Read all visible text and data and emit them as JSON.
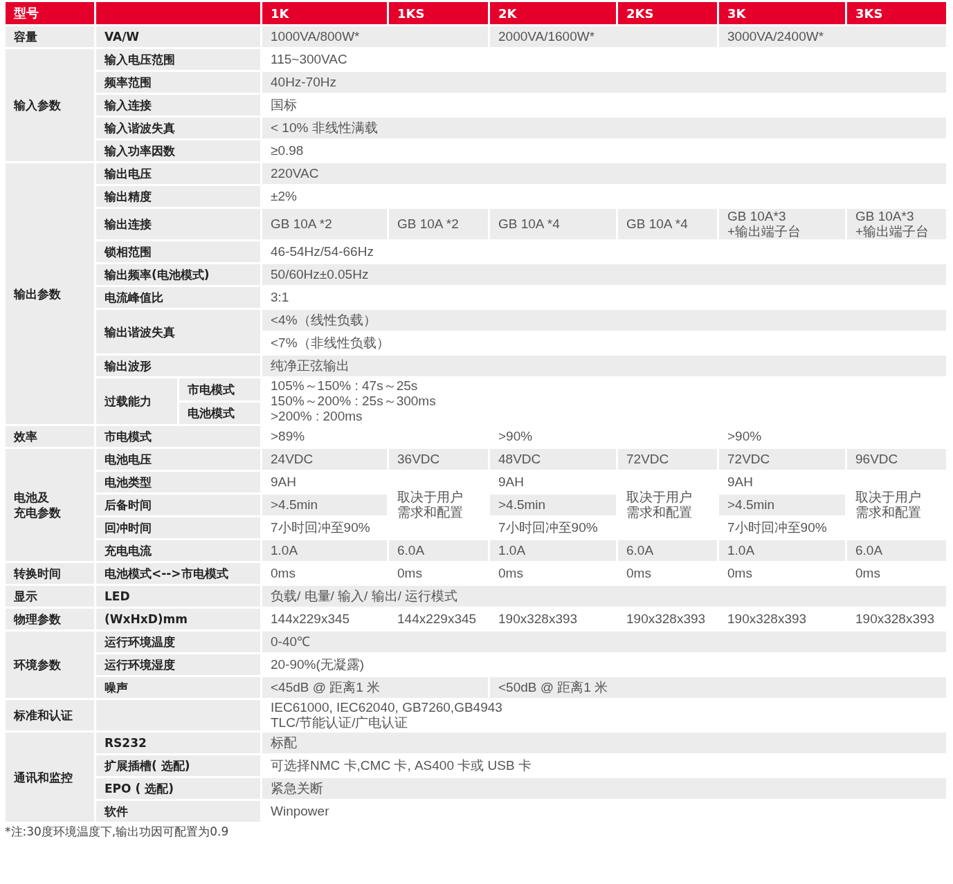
{
  "table": {
    "header": {
      "model": "型号",
      "columns": [
        "1K",
        "1KS",
        "2K",
        "2KS",
        "3K",
        "3KS"
      ]
    },
    "rows": [
      {
        "group": "容量",
        "parameter": "VA/W",
        "values": [
          "1000VA/800W*",
          "2000VA/1600W*",
          "3000VA/2400W*"
        ]
      },
      {
        "group": "输入参数",
        "parameter": "输入电压范围",
        "values": [
          "115~300VAC"
        ]
      },
      {
        "parameter": "频率范围",
        "values": [
          "40Hz-70Hz"
        ]
      },
      {
        "parameter": "输入连接",
        "values": [
          "国标"
        ]
      },
      {
        "parameter": "输入谐波失真",
        "values": [
          "< 10% 非线性满载"
        ]
      },
      {
        "parameter": "输入功率因数",
        "values": [
          "≥0.98"
        ]
      },
      {
        "group": "输出参数",
        "parameter": "输出电压",
        "values": [
          "220VAC"
        ]
      },
      {
        "parameter": "输出精度",
        "values": [
          "±2%"
        ]
      },
      {
        "parameter": "输出连接",
        "values": [
          "GB 10A *2",
          "GB 10A *2",
          "GB 10A *4",
          "GB 10A *4",
          [
            "GB 10A*3",
            "+输出端子台"
          ],
          [
            "GB 10A*3",
            "+输出端子台"
          ]
        ]
      },
      {
        "parameter": "锁相范围",
        "values": [
          "46-54Hz/54-66Hz"
        ]
      },
      {
        "parameter": "输出频率(电池模式)",
        "values": [
          "50/60Hz±0.05Hz"
        ]
      },
      {
        "parameter": "电流峰值比",
        "values": [
          "3:1"
        ]
      },
      {
        "parameter": "输出谐波失真",
        "values": [
          "<4%（线性负载）"
        ]
      },
      {
        "values": [
          "<7%（非线性负载）"
        ]
      },
      {
        "parameter": "输出波形",
        "values": [
          "纯净正弦输出"
        ]
      },
      {
        "parameter": "过载能力",
        "mode": "市电模式",
        "values": [
          [
            "105%～150% : 47s～25s",
            "150%～200% : 25s～300ms",
            ">200% : 200ms"
          ]
        ]
      },
      {
        "mode": "电池模式"
      },
      {
        "group": "效率",
        "parameter": "市电模式",
        "values": [
          ">89%",
          ">90%",
          ">90%"
        ]
      },
      {
        "group": [
          "电池及",
          "充电参数"
        ],
        "parameter": "电池电压",
        "values": [
          "24VDC",
          "36VDC",
          "48VDC",
          "72VDC",
          "72VDC",
          "96VDC"
        ]
      },
      {
        "parameter": "电池类型",
        "values": [
          "9AH",
          [
            "取决于用户",
            "需求和配置"
          ],
          "9AH",
          [
            "取决于用户",
            "需求和配置"
          ],
          "9AH",
          [
            "取决于用户",
            "需求和配置"
          ]
        ]
      },
      {
        "parameter": "后备时间",
        "values": [
          ">4.5min",
          ">4.5min",
          ">4.5min"
        ]
      },
      {
        "parameter": "回冲时间",
        "values": [
          "7小时回冲至90%",
          "7小时回冲至90%",
          "7小时回冲至90%"
        ]
      },
      {
        "parameter": "充电电流",
        "values": [
          "1.0A",
          "6.0A",
          "1.0A",
          "6.0A",
          "1.0A",
          "6.0A"
        ]
      },
      {
        "group": "转换时间",
        "parameter": "电池模式<-->市电模式",
        "values": [
          "0ms",
          "0ms",
          "0ms",
          "0ms",
          "0ms",
          "0ms"
        ]
      },
      {
        "group": "显示",
        "parameter": "LED",
        "values": [
          "负载/ 电量/ 输入/ 输出/ 运行模式"
        ]
      },
      {
        "group": "物理参数",
        "parameter": "(WxHxD)mm",
        "values": [
          "144x229x345",
          "144x229x345",
          "190x328x393",
          "190x328x393",
          "190x328x393",
          "190x328x393"
        ]
      },
      {
        "group": "环境参数",
        "parameter": "运行环境温度",
        "values": [
          "0-40℃"
        ]
      },
      {
        "parameter": "运行环境湿度",
        "values": [
          "20-90%(无凝露)"
        ]
      },
      {
        "parameter": "噪声",
        "values": [
          "<45dB @ 距离1 米",
          "<50dB @ 距离1 米"
        ]
      },
      {
        "group": "标准和认证",
        "values": [
          [
            "IEC61000, IEC62040, GB7260,GB4943",
            "TLC/节能认证/广电认证"
          ]
        ]
      },
      {
        "group": "通讯和监控",
        "parameter": "RS232",
        "values": [
          "标配"
        ]
      },
      {
        "parameter": "扩展插槽( 选配)",
        "values": [
          "可选择NMC 卡,CMC 卡, AS400 卡或 USB 卡"
        ]
      },
      {
        "parameter": "EPO ( 选配)",
        "values": [
          "紧急关断"
        ]
      },
      {
        "parameter": "软件",
        "values": [
          "Winpower"
        ]
      }
    ]
  },
  "footnote": "*注:30度环境温度下,输出功因可配置为0.9"
}
